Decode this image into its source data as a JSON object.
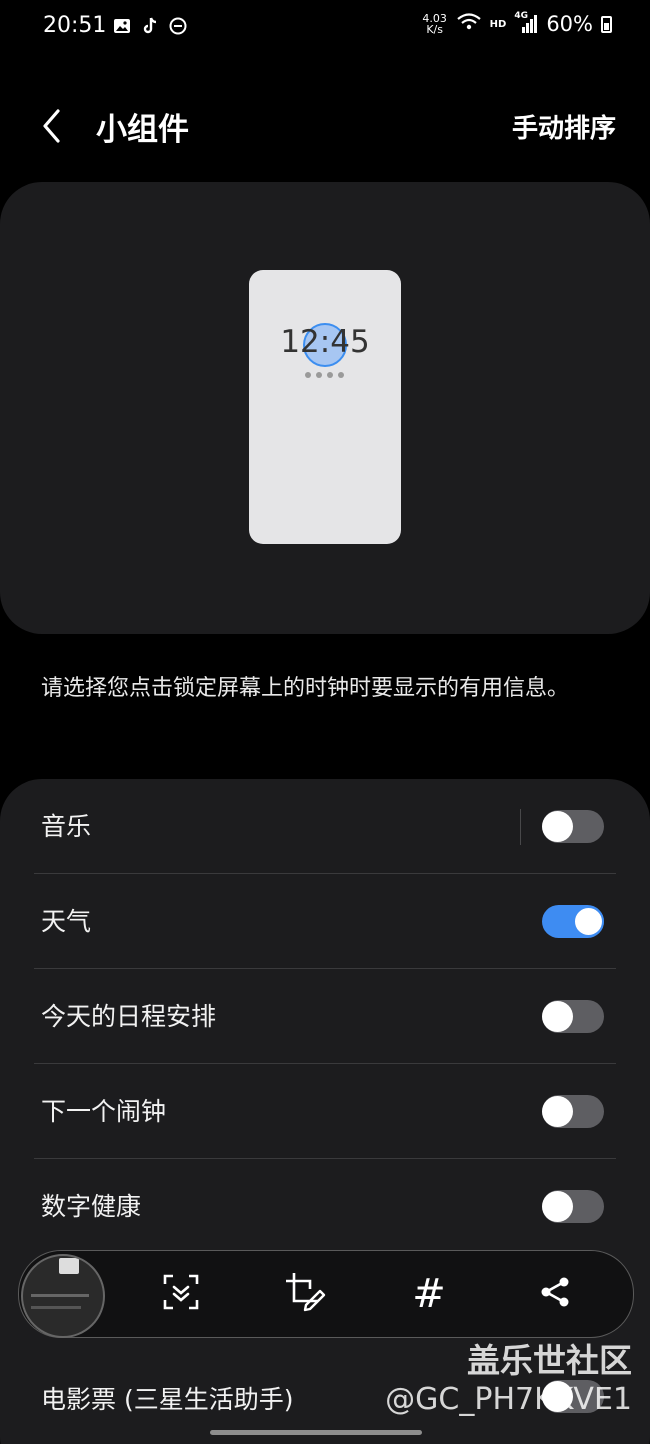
{
  "status_bar": {
    "time": "20:51",
    "left_icons": [
      "gallery-icon",
      "tiktok-icon",
      "dnd-icon"
    ],
    "net_speed_value": "4.03",
    "net_speed_unit": "K/s",
    "hd_label": "HD",
    "network_label": "4G",
    "battery_percent": "60%"
  },
  "header": {
    "title": "小组件",
    "action_label": "手动排序"
  },
  "preview": {
    "clock_text": "12:45",
    "page_dots": 4
  },
  "description": "请选择您点击锁定屏幕上的时钟时要显示的有用信息。",
  "settings": {
    "items": [
      {
        "label": "音乐",
        "enabled": false
      },
      {
        "label": "天气",
        "enabled": true
      },
      {
        "label": "今天的日程安排",
        "enabled": false
      },
      {
        "label": "下一个闹钟",
        "enabled": false
      },
      {
        "label": "数字健康",
        "enabled": false
      }
    ],
    "last_item": {
      "label": "电影票 (三星生活助手)",
      "enabled": false
    }
  },
  "screenshot_toolbar": {
    "buttons": [
      "scan-icon",
      "crop-edit-icon",
      "hashtag-icon",
      "share-icon"
    ],
    "hash_glyph": "#"
  },
  "watermark": {
    "line1": "盖乐世社区",
    "line2": "@GC_PH7KKVE1"
  },
  "colors": {
    "background": "#000000",
    "card": "#1c1c1e",
    "toggle_on": "#3e8cf2",
    "toggle_off": "#5e5e62"
  }
}
